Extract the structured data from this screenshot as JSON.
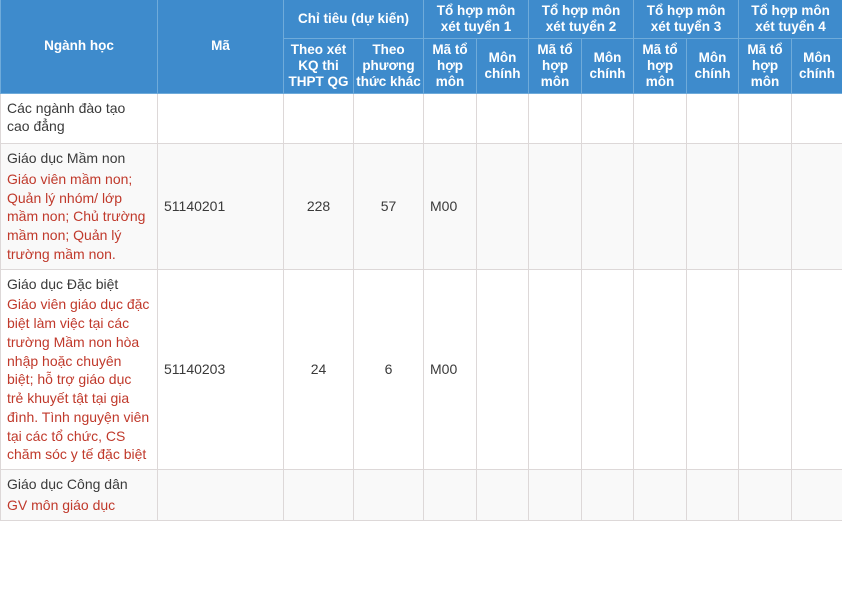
{
  "table": {
    "columns": {
      "major": "Ngành học",
      "code": "Mã",
      "quota_group": "Chỉ tiêu (dự kiến)",
      "quota_thptqg": "Theo xét KQ thi THPT QG",
      "quota_other": "Theo phương thức khác",
      "combo_code": "Mã tổ hợp môn",
      "combo_main": "Môn chính",
      "groups": [
        "Tổ hợp môn xét tuyển 1",
        "Tổ hợp môn xét tuyển 2",
        "Tổ hợp môn xét tuyển 3",
        "Tổ hợp môn xét tuyển 4"
      ]
    },
    "rows": [
      {
        "major_title": "Các ngành đào tạo cao đẳng",
        "major_desc": "",
        "code": "",
        "quota_thptqg": "",
        "quota_other": "",
        "combo1_code": "",
        "combo1_main": "",
        "combo2_code": "",
        "combo2_main": "",
        "combo3_code": "",
        "combo3_main": "",
        "combo4_code": "",
        "combo4_main": ""
      },
      {
        "major_title": "Giáo dục Mầm non",
        "major_desc": "Giáo viên mầm non; Quản lý nhóm/ lớp mầm non; Chủ trường mầm non; Quản lý trường mầm non.",
        "code": "51140201",
        "quota_thptqg": "228",
        "quota_other": "57",
        "combo1_code": "M00",
        "combo1_main": "",
        "combo2_code": "",
        "combo2_main": "",
        "combo3_code": "",
        "combo3_main": "",
        "combo4_code": "",
        "combo4_main": ""
      },
      {
        "major_title": "Giáo dục Đặc biệt",
        "major_desc": "Giáo viên giáo dục đặc biệt làm việc tại các trường Mầm non hòa nhập hoặc chuyên biệt; hỗ trợ giáo dục trẻ khuyết tật tại gia đình. Tình nguyện viên tại các tổ chức, CS chăm sóc y tế đặc biệt",
        "code": "51140203",
        "quota_thptqg": "24",
        "quota_other": "6",
        "combo1_code": "M00",
        "combo1_main": "",
        "combo2_code": "",
        "combo2_main": "",
        "combo3_code": "",
        "combo3_main": "",
        "combo4_code": "",
        "combo4_main": ""
      },
      {
        "major_title": "Giáo dục Công dân",
        "major_desc": "GV môn giáo dục",
        "code": "",
        "quota_thptqg": "",
        "quota_other": "",
        "combo1_code": "",
        "combo1_main": "",
        "combo2_code": "",
        "combo2_main": "",
        "combo3_code": "",
        "combo3_main": "",
        "combo4_code": "",
        "combo4_main": ""
      }
    ]
  },
  "colors": {
    "header_blue": "#3E8BCC",
    "desc_red": "#C0392B",
    "row_alt": "#F9F9F9",
    "border": "#DDD8D8"
  }
}
